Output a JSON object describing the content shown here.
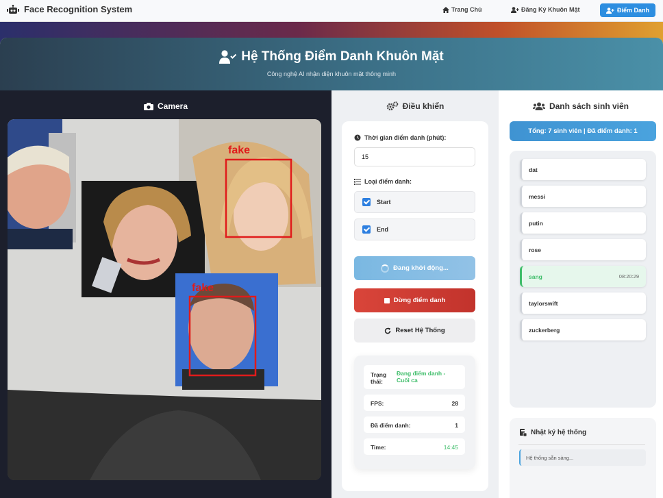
{
  "nav": {
    "brand": "Face Recognition System",
    "links": [
      {
        "label": "Trang Chủ"
      },
      {
        "label": "Đăng Ký Khuôn Mặt"
      },
      {
        "label": "Điểm Danh"
      }
    ]
  },
  "header": {
    "title": "Hệ Thống Điểm Danh Khuôn Mặt",
    "subtitle": "Công nghệ AI nhận diện khuôn mặt thông minh"
  },
  "camera": {
    "title": "Camera",
    "detections": [
      {
        "label": "fake"
      },
      {
        "label": "fake"
      }
    ]
  },
  "controls": {
    "title": "Điều khiển",
    "time_label": "Thời gian điểm danh (phút):",
    "time_value": "15",
    "type_label": "Loại điểm danh:",
    "options": [
      {
        "label": "Start",
        "checked": true
      },
      {
        "label": "End",
        "checked": true
      }
    ],
    "start_button": "Đang khởi động...",
    "stop_button": "Dừng điểm danh",
    "reset_button": "Reset Hệ Thống",
    "status": [
      {
        "key": "Trạng thái:",
        "value": "Đang điểm danh - Cuối ca"
      },
      {
        "key": "FPS:",
        "value": "28"
      },
      {
        "key": "Đã điểm danh:",
        "value": "1"
      },
      {
        "key": "Time:",
        "value": "14:45"
      }
    ]
  },
  "students": {
    "title": "Danh sách sinh viên",
    "summary": "Tổng: 7 sinh viên | Đã điểm danh: 1",
    "items": [
      {
        "name": "dat",
        "time": ""
      },
      {
        "name": "messi",
        "time": ""
      },
      {
        "name": "putin",
        "time": ""
      },
      {
        "name": "rose",
        "time": ""
      },
      {
        "name": "sang",
        "time": "08:20:29"
      },
      {
        "name": "taylorswift",
        "time": ""
      },
      {
        "name": "zuckerberg",
        "time": ""
      }
    ]
  },
  "log": {
    "title": "Nhật ký hệ thống",
    "entries": [
      "Hệ thống sẵn sàng..."
    ]
  },
  "colors": {
    "accent": "#2d8ee0",
    "stop": "#d9453a",
    "present": "#3fbd6a",
    "detection_box": "#e01b1b"
  }
}
